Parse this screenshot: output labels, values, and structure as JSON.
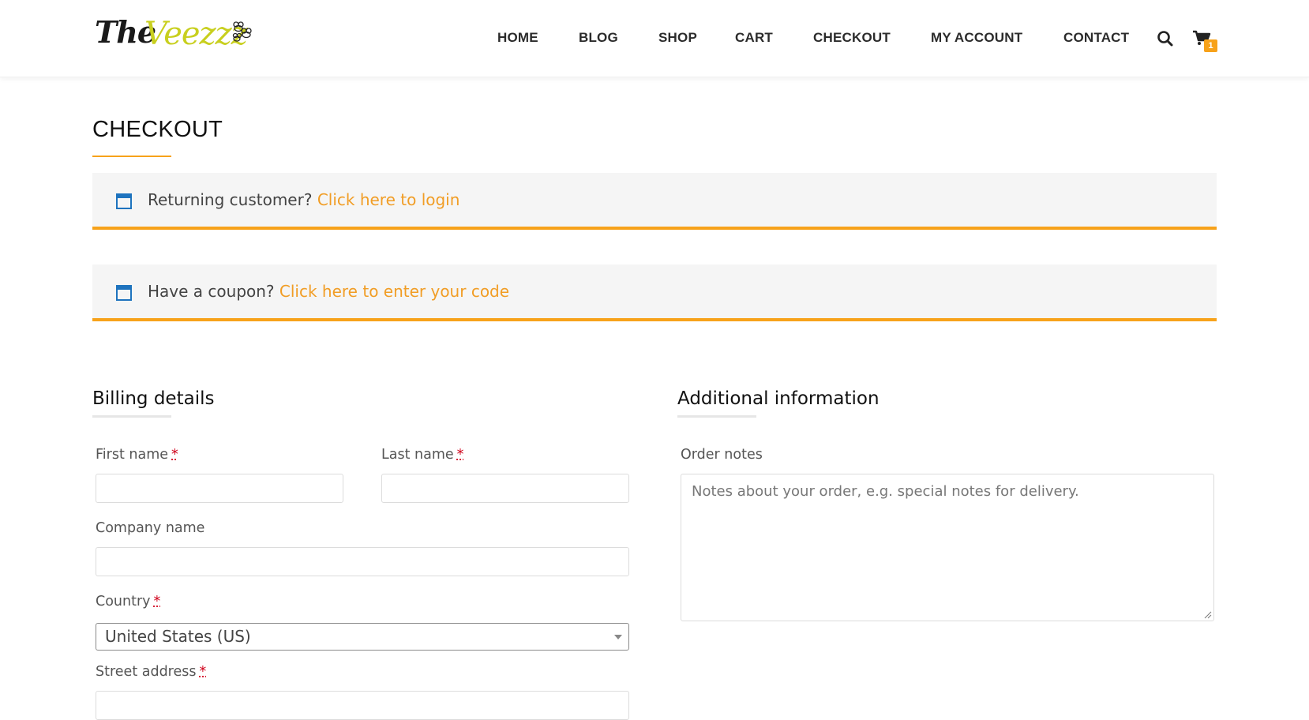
{
  "brand": {
    "logo_the": "The",
    "logo_veezzz": "Veezzz"
  },
  "nav": {
    "items": [
      "HOME",
      "BLOG",
      "SHOP",
      "CART",
      "CHECKOUT",
      "MY ACCOUNT",
      "CONTACT"
    ],
    "search_icon": "search-icon",
    "cart_icon": "cart-icon",
    "cart_count": "1"
  },
  "page": {
    "title": "CHECKOUT"
  },
  "notices": {
    "login": {
      "text": "Returning customer?",
      "link": "Click here to login"
    },
    "coupon": {
      "text": "Have a coupon?",
      "link": "Click here to enter your code"
    }
  },
  "billing": {
    "heading": "Billing details",
    "first_name_label": "First name",
    "last_name_label": "Last name",
    "company_label": "Company name",
    "country_label": "Country",
    "country_value": "United States (US)",
    "street_label": "Street address",
    "required_marker": "*"
  },
  "additional": {
    "heading": "Additional information",
    "order_notes_label": "Order notes",
    "order_notes_placeholder": "Notes about your order, e.g. special notes for delivery."
  },
  "colors": {
    "accent": "#f7a21a",
    "link": "#f19d25",
    "logo_green": "#c8cf1e",
    "notice_bg": "#f5f5f5"
  }
}
